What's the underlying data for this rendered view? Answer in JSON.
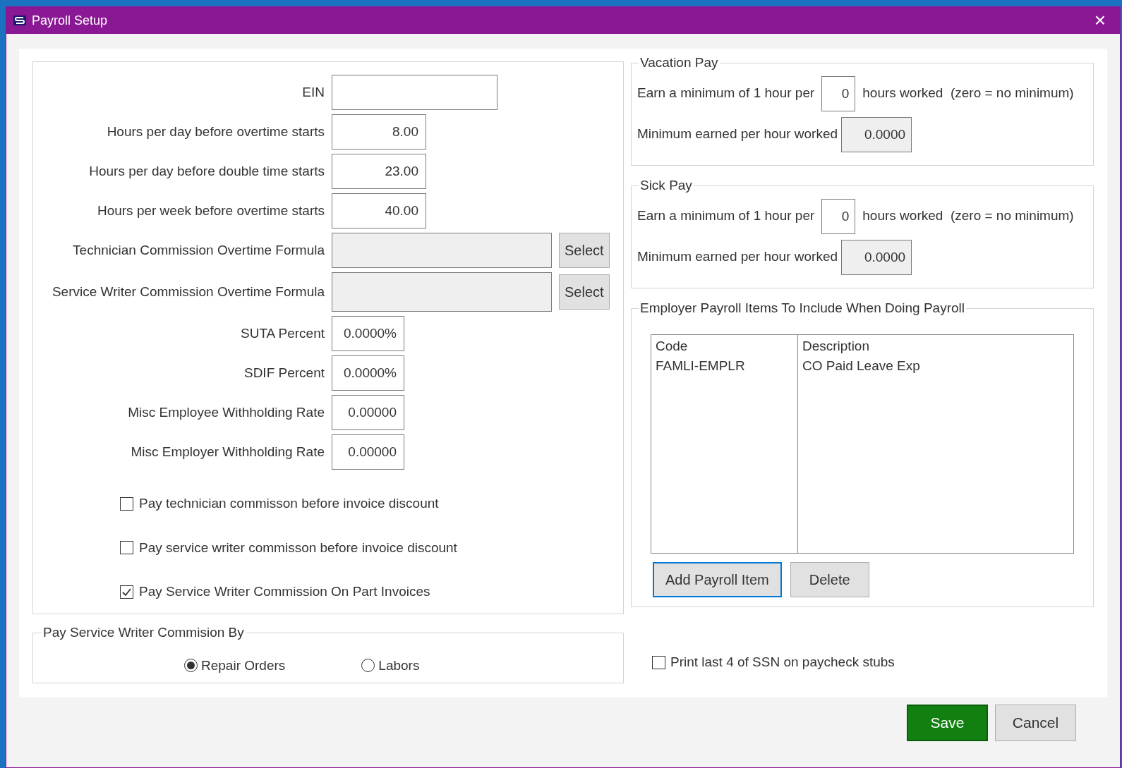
{
  "window": {
    "title": "Payroll Setup",
    "close": "×"
  },
  "form_fields": [
    {
      "label": "EIN",
      "kind": "wide"
    },
    {
      "label": "Hours per day before overtime starts",
      "value": "8.00",
      "kind": "hours"
    },
    {
      "label": "Hours per day before double time starts",
      "value": "23.00",
      "kind": "hours"
    },
    {
      "label": "Hours per week before overtime starts",
      "value": "40.00",
      "kind": "hours"
    },
    {
      "label": "Technician Commission Overtime Formula",
      "kind": "formula",
      "button": "Select"
    },
    {
      "label": "Service Writer Commission Overtime Formula",
      "kind": "formula",
      "button": "Select"
    },
    {
      "label": "SUTA Percent",
      "value": "0.0000%",
      "kind": "rate"
    },
    {
      "label": "SDIF Percent",
      "value": "0.0000%",
      "kind": "rate"
    },
    {
      "label": "Misc Employee Withholding Rate",
      "value": "0.00000",
      "kind": "rate"
    },
    {
      "label": "Misc Employer Withholding Rate",
      "value": "0.00000",
      "kind": "rate"
    }
  ],
  "checkboxes": [
    {
      "label": "Pay technician commisson before invoice discount",
      "checked": false
    },
    {
      "label": "Pay service writer commisson before invoice discount",
      "checked": false
    },
    {
      "label": "Pay Service Writer Commission On Part Invoices",
      "checked": true
    }
  ],
  "commission_by": {
    "title": "Pay Service Writer Commision By",
    "options": [
      {
        "label": "Repair Orders",
        "selected": true
      },
      {
        "label": "Labors",
        "selected": false
      }
    ]
  },
  "leave_groups": [
    {
      "title": "Vacation Pay",
      "earn_before": "Earn a minimum of 1 hour per",
      "earn_value": "0",
      "earn_after": "hours worked  (zero = no minimum)",
      "min_label": "Minimum earned per hour worked",
      "min_value": "0.0000"
    },
    {
      "title": "Sick Pay",
      "earn_before": "Earn a minimum of 1 hour per",
      "earn_value": "0",
      "earn_after": "hours worked  (zero = no minimum)",
      "min_label": "Minimum earned per hour worked",
      "min_value": "0.0000"
    }
  ],
  "payroll_items": {
    "title": "Employer Payroll Items To Include When Doing Payroll",
    "columns": [
      "Code",
      "Description"
    ],
    "rows": [
      [
        "FAMLI-EMPLR",
        "CO Paid Leave Exp"
      ]
    ],
    "buttons": [
      {
        "label": "Add Payroll Item",
        "focused": true
      },
      {
        "label": "Delete",
        "focused": false
      }
    ]
  },
  "print_ssn": {
    "label": "Print last 4 of SSN on paycheck stubs",
    "checked": false
  },
  "buttons": [
    {
      "label": "Save",
      "kind": "primary"
    },
    {
      "label": "Cancel",
      "kind": "default"
    }
  ]
}
